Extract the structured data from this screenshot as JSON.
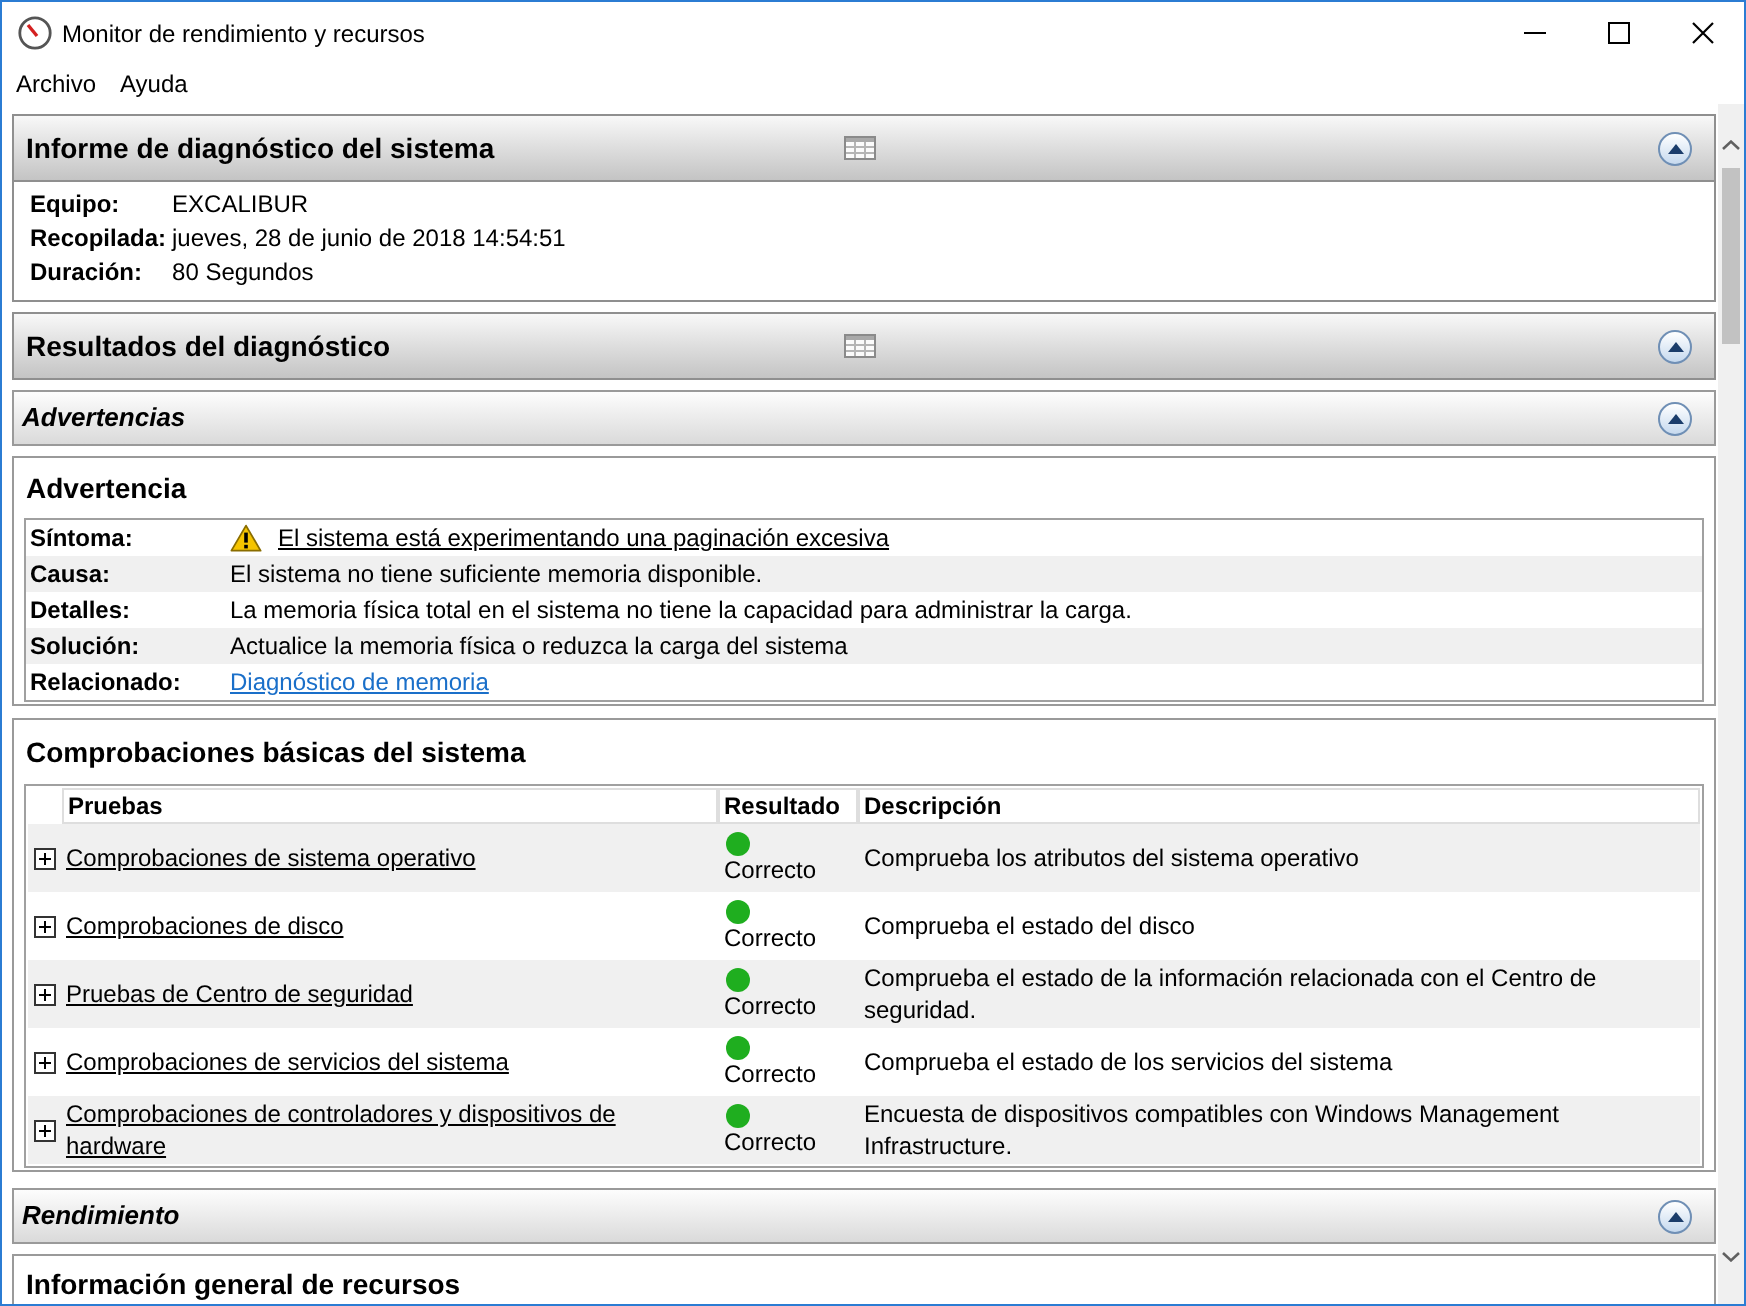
{
  "window": {
    "title": "Monitor de rendimiento y recursos"
  },
  "menu": [
    {
      "label": "Archivo"
    },
    {
      "label": "Ayuda"
    }
  ],
  "blocks": [
    {
      "kind": "section",
      "title": "Informe de diagnóstico del sistema",
      "expanded": true,
      "fields": [
        {
          "label": "Equipo:",
          "value": "EXCALIBUR"
        },
        {
          "label": "Recopilada:",
          "value": "jueves, 28 de junio de 2018 14:54:51"
        },
        {
          "label": "Duración:",
          "value": "80 Segundos"
        }
      ]
    },
    {
      "kind": "section",
      "title": "Resultados del diagnóstico",
      "expanded": true
    },
    {
      "kind": "subsection",
      "title": "Advertencias",
      "expanded": true
    },
    {
      "kind": "warning",
      "title": "Advertencia",
      "rows": [
        {
          "label": "Síntoma:",
          "kind": "alert_link",
          "value": "El sistema está experimentando una paginación excesiva"
        },
        {
          "label": "Causa:",
          "kind": "text",
          "value": "El sistema no tiene suficiente memoria disponible."
        },
        {
          "label": "Detalles:",
          "kind": "text",
          "value": "La memoria física total en el sistema no tiene la capacidad para administrar la carga."
        },
        {
          "label": "Solución:",
          "kind": "text",
          "value": "Actualice la memoria física o reduzca la carga del sistema"
        },
        {
          "label": "Relacionado:",
          "kind": "link",
          "value": "Diagnóstico de memoria"
        }
      ]
    },
    {
      "kind": "checks",
      "title": "Comprobaciones básicas del sistema",
      "columns": [
        "Pruebas",
        "Resultado",
        "Descripción"
      ],
      "rows": [
        {
          "test": "Comprobaciones de sistema operativo",
          "expanded": false,
          "result": "Correcto",
          "color": "#1fae1f",
          "description": "Comprueba los atributos del sistema operativo"
        },
        {
          "test": "Comprobaciones de disco",
          "expanded": false,
          "result": "Correcto",
          "color": "#1fae1f",
          "description": "Comprueba el estado del disco"
        },
        {
          "test": "Pruebas de Centro de seguridad",
          "expanded": false,
          "result": "Correcto",
          "color": "#1fae1f",
          "description": "Comprueba el estado de la información relacionada con el Centro de seguridad."
        },
        {
          "test": "Comprobaciones de servicios del sistema",
          "expanded": false,
          "result": "Correcto",
          "color": "#1fae1f",
          "description": "Comprueba el estado de los servicios del sistema"
        },
        {
          "test": "Comprobaciones de controladores y dispositivos de hardware",
          "expanded": false,
          "result": "Correcto",
          "color": "#1fae1f",
          "description": "Encuesta de dispositivos compatibles con Windows Management Infrastructure."
        }
      ]
    },
    {
      "kind": "subsection",
      "title": "Rendimiento",
      "expanded": true
    },
    {
      "kind": "panel",
      "title": "Información general de recursos"
    }
  ]
}
